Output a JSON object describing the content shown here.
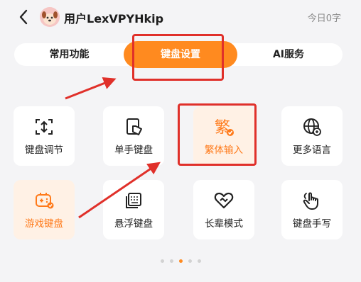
{
  "header": {
    "username": "用户LexVPYHkip",
    "today_count": "今日0字",
    "back_icon": "chevron-left-icon",
    "avatar_icon": "dog-avatar-icon"
  },
  "tabs": [
    {
      "label": "常用功能",
      "active": false
    },
    {
      "label": "键盘设置",
      "active": true
    },
    {
      "label": "AI服务",
      "active": false
    }
  ],
  "grid": [
    {
      "label": "键盘调节",
      "icon": "keyboard-adjust-icon",
      "highlight": false
    },
    {
      "label": "单手键盘",
      "icon": "one-hand-keyboard-icon",
      "highlight": false
    },
    {
      "label": "繁体输入",
      "icon": "traditional-chinese-icon",
      "highlight": true,
      "glyph": "繁"
    },
    {
      "label": "更多语言",
      "icon": "globe-icon",
      "highlight": false
    },
    {
      "label": "游戏键盘",
      "icon": "gamepad-icon",
      "highlight": true
    },
    {
      "label": "悬浮键盘",
      "icon": "floating-keyboard-icon",
      "highlight": false
    },
    {
      "label": "长辈模式",
      "icon": "heart-icon",
      "highlight": false
    },
    {
      "label": "键盘手写",
      "icon": "handwriting-icon",
      "highlight": false
    }
  ],
  "pagination": {
    "total": 5,
    "current": 3
  },
  "colors": {
    "accent": "#ff8a1f",
    "highlight_bg": "#fff1e5",
    "annotation_red": "#e0302a",
    "background": "#f4f4f6"
  }
}
